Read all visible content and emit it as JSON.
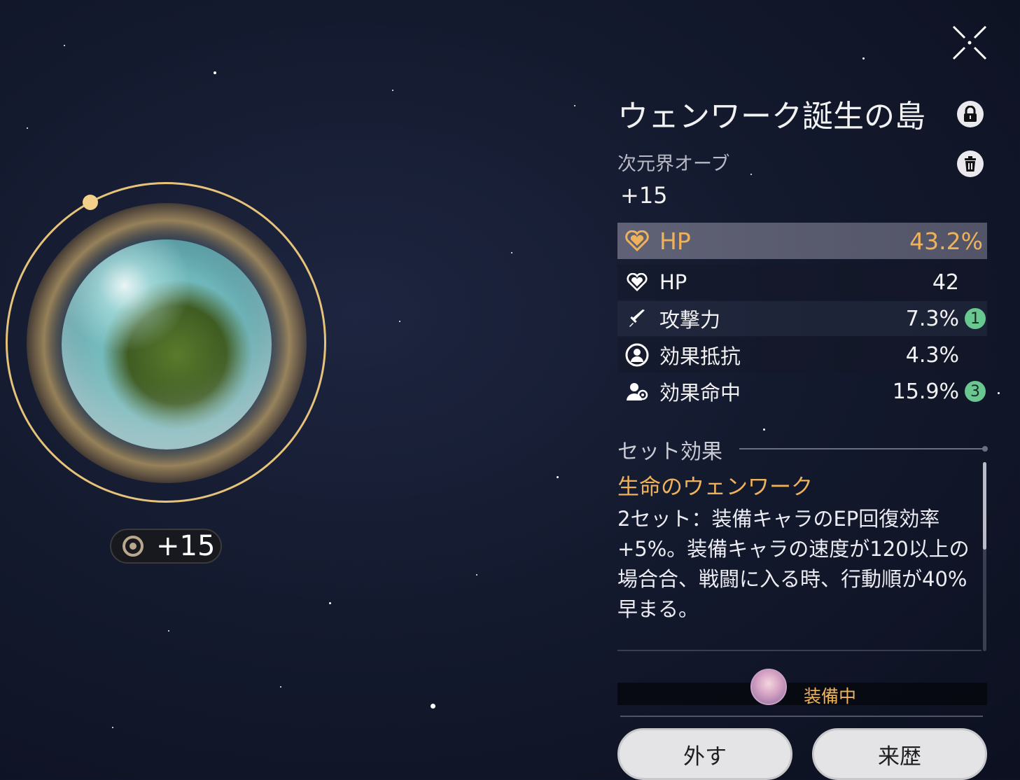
{
  "relic": {
    "title": "ウェンワーク誕生の島",
    "type": "次元界オーブ",
    "level": "+15",
    "level_badge": "+15"
  },
  "main_stat": {
    "name": "HP",
    "value": "43.2%",
    "icon": "heart-icon",
    "color": "#efb25a"
  },
  "sub_stats": [
    {
      "name": "HP",
      "value": "42",
      "icon": "heart-icon",
      "rolls": ""
    },
    {
      "name": "攻撃力",
      "value": "7.3%",
      "icon": "sword-icon",
      "rolls": "1"
    },
    {
      "name": "効果抵抗",
      "value": "4.3%",
      "icon": "shield-person-icon",
      "rolls": ""
    },
    {
      "name": "効果命中",
      "value": "15.9%",
      "icon": "target-person-icon",
      "rolls": "3"
    }
  ],
  "set_bonus": {
    "header": "セット効果",
    "name": "生命のウェンワーク",
    "description": "2セット：装備キャラのEP回復効率+5%。装備キャラの速度が120以上の場合合、戦闘に入る時、行動順が40%早まる。"
  },
  "equipped": {
    "label": "装備中"
  },
  "buttons": {
    "unequip": "外す",
    "history": "来歴"
  },
  "colors": {
    "accent": "#efb25a",
    "badge_green": "#69c790"
  }
}
